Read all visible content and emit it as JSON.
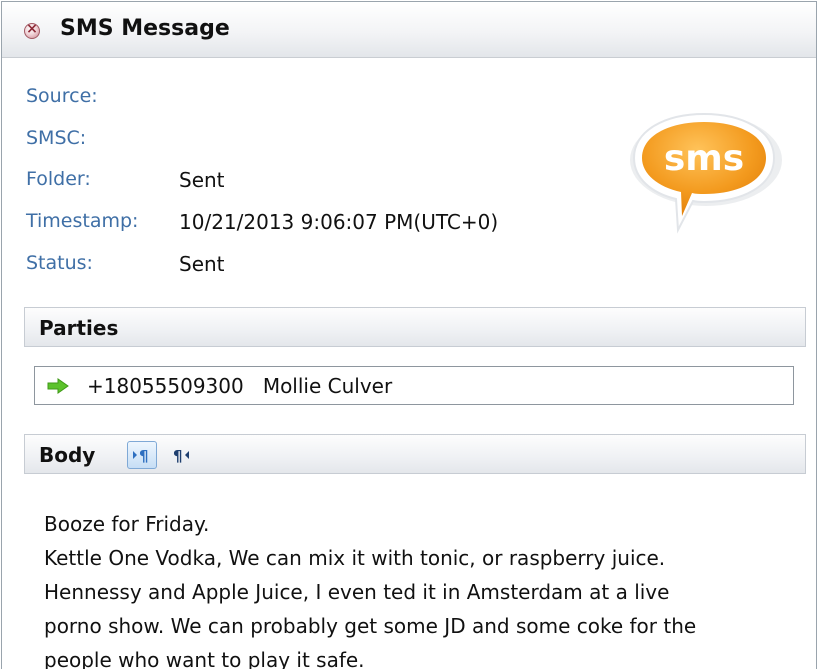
{
  "window": {
    "title": "SMS Message"
  },
  "fields": [
    {
      "label": "Source:",
      "value": ""
    },
    {
      "label": "SMSC:",
      "value": ""
    },
    {
      "label": "Folder:",
      "value": "Sent"
    },
    {
      "label": "Timestamp:",
      "value": "10/21/2013 9:06:07 PM(UTC+0)"
    },
    {
      "label": "Status:",
      "value": "Sent"
    }
  ],
  "logo": {
    "text": "sms",
    "color": "#f39a1e",
    "icon": "sms-speech-bubble-icon"
  },
  "parties": {
    "header": "Parties",
    "number": "+18055509300",
    "name": "Mollie Culver",
    "icon": "green-right-arrow-icon"
  },
  "body": {
    "header": "Body",
    "toolbar": [
      {
        "icon": "left-to-right-paragraph-icon",
        "active": true
      },
      {
        "icon": "right-to-left-paragraph-icon",
        "active": false
      }
    ],
    "lines": [
      "Booze for Friday.",
      "Kettle One Vodka, We can mix it with tonic, or raspberry juice.",
      "Hennessy and Apple Juice, I even ted it in Amsterdam at a live",
      "porno show. We can probably get some JD and some coke for the",
      "people who want to play it safe."
    ]
  },
  "colors": {
    "label_blue": "#3f6fa6",
    "accent_orange": "#f39a1e",
    "arrow_green": "#5cc22c"
  }
}
